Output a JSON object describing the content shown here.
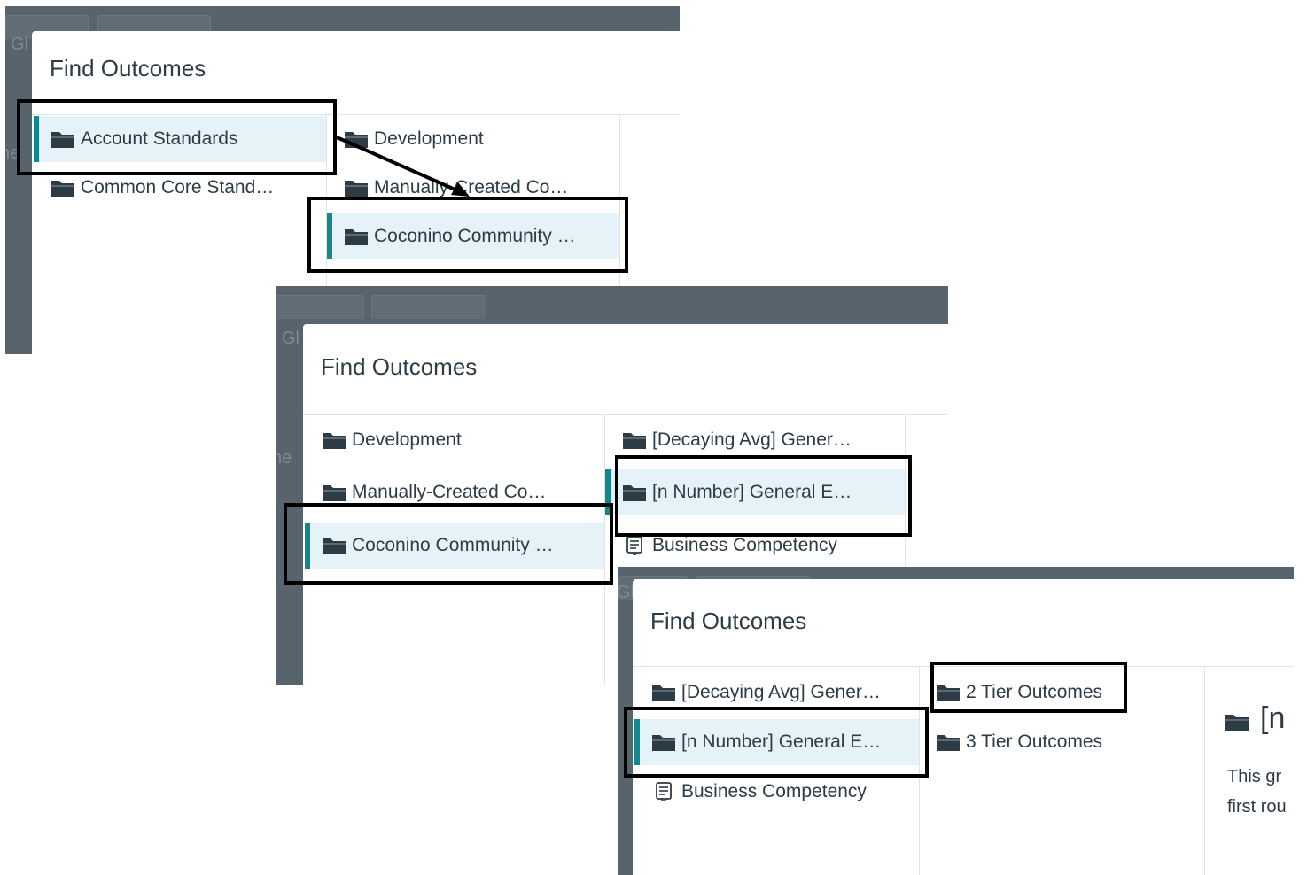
{
  "panel1": {
    "title": "Find Outcomes",
    "bg_tab_text": "Gl",
    "bg_side_text": "ne",
    "col1": [
      "Account Standards",
      "Common Core Stand…"
    ],
    "col2": [
      "Development",
      "Manually-Created Co…",
      "Coconino Community …"
    ]
  },
  "panel2": {
    "title": "Find Outcomes",
    "bg_tab_text": "Gl",
    "bg_side_text": "ne",
    "col1": [
      "Development",
      "Manually-Created Co…",
      "Coconino Community …"
    ],
    "col2": [
      "[Decaying Avg] Gener…",
      "[n Number] General E…",
      "Business Competency"
    ]
  },
  "panel3": {
    "title": "Find Outcomes",
    "bg_tab_text": "Gl",
    "col1": [
      "[Decaying Avg] Gener…",
      "[n Number] General E…",
      "Business Competency"
    ],
    "col2": [
      "2 Tier Outcomes",
      "3 Tier Outcomes"
    ],
    "detail_title": "[n",
    "detail_line1": "This gr",
    "detail_line2": "first rou"
  },
  "colors": {
    "accent": "#0e8a8f",
    "selected_bg": "#e5f2f8",
    "overlay": "#58646d",
    "highlight_border": "#000000"
  },
  "icons": {
    "folder": "folder-icon",
    "outcome": "outcome-document-icon"
  }
}
